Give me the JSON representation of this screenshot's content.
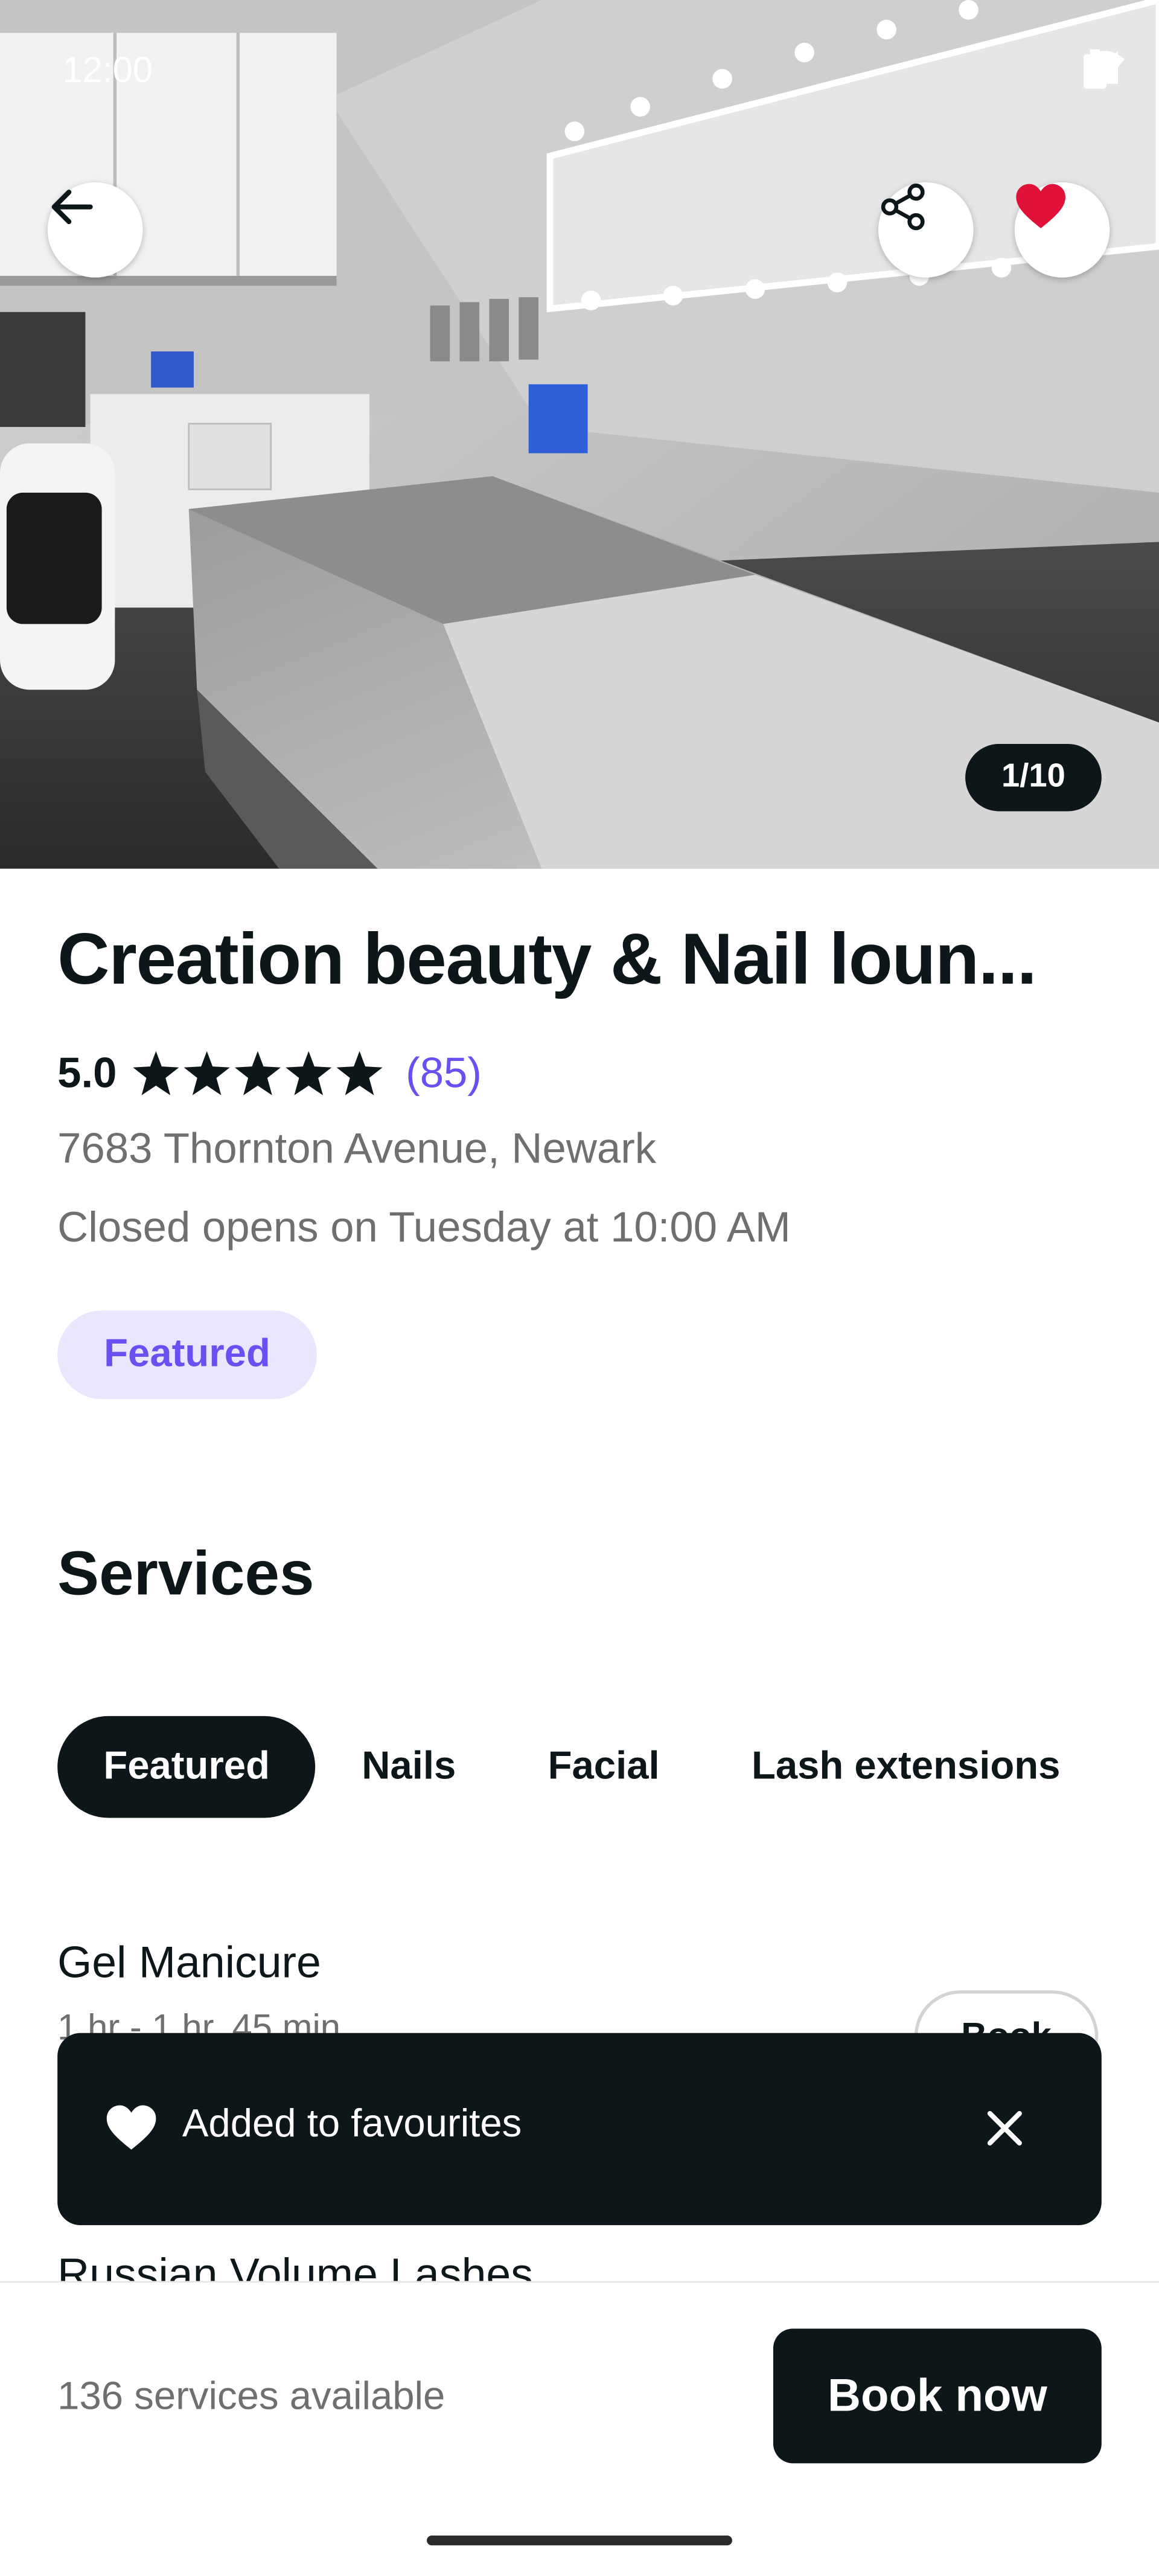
{
  "status_bar": {
    "time": "12:00"
  },
  "gallery": {
    "counter": "1/10"
  },
  "venue": {
    "name": "Creation beauty & Nail loun...",
    "rating": "5.0",
    "stars": 5,
    "review_count": "(85)",
    "address": "7683 Thornton Avenue, Newark",
    "hours": "Closed opens on Tuesday at 10:00 AM",
    "badge": "Featured"
  },
  "services": {
    "heading": "Services",
    "tabs": [
      {
        "label": "Featured",
        "active": true
      },
      {
        "label": "Nails",
        "active": false
      },
      {
        "label": "Facial",
        "active": false
      },
      {
        "label": "Lash extensions",
        "active": false
      }
    ],
    "items": [
      {
        "name": "Gel Manicure",
        "duration": "1 hr - 1 hr, 45 min",
        "book_label": "Book"
      },
      {
        "name": "Russian Volume Lashes"
      }
    ]
  },
  "toast": {
    "message": "Added to favourites"
  },
  "footer": {
    "available": "136 services available",
    "book_label": "Book now"
  },
  "colors": {
    "accent": "#6950f3",
    "dark": "#0d1619",
    "favourite": "#e0123a"
  }
}
